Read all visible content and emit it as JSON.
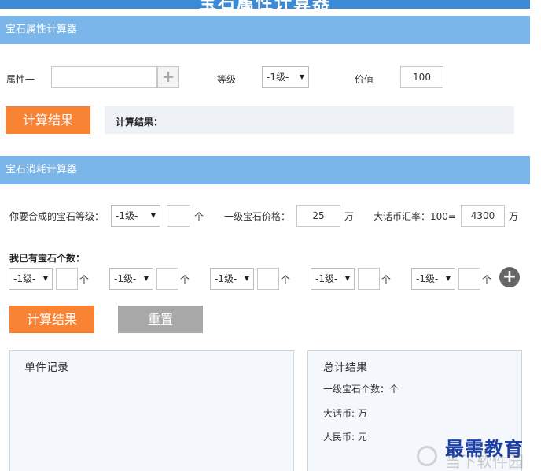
{
  "banner": {
    "title": "宝石属性计算器"
  },
  "attr_calc": {
    "header": "宝石属性计算器",
    "attr_label": "属性一",
    "attr_value": "",
    "level_label": "等级",
    "level_select": "-1级-",
    "value_label": "价值",
    "value_input": "100",
    "calc_button": "计算结果",
    "result_label": "计算结果："
  },
  "consume_calc": {
    "header": "宝石消耗计算器",
    "target_level_label": "你要合成的宝石等级：",
    "target_level_select": "-1级-",
    "target_count": "",
    "unit_ge": "个",
    "price_label": "一级宝石价格：",
    "price_value": "25",
    "unit_wan": "万",
    "rate_label": "大话币汇率：100=",
    "rate_value": "4300",
    "owned_label": "我已有宝石个数：",
    "owned_rows": [
      {
        "level": "-1级-",
        "count": "",
        "unit": "个"
      },
      {
        "level": "-1级-",
        "count": "",
        "unit": "个"
      },
      {
        "level": "-1级-",
        "count": "",
        "unit": "个"
      },
      {
        "level": "-1级-",
        "count": "",
        "unit": "个"
      },
      {
        "level": "-1级-",
        "count": "",
        "unit": "个"
      }
    ],
    "add_icon": "plus-circle-icon",
    "calc_button": "计算结果",
    "reset_button": "重置"
  },
  "records": {
    "title": "单件记录"
  },
  "totals": {
    "title": "总计结果",
    "gem_count": "一级宝石个数：个",
    "dahua_coin": "大话币: 万",
    "rmb": "人民币: 元"
  },
  "watermark": {
    "main": "最需教育",
    "sub": "当下软件园"
  },
  "colors": {
    "header_bg": "#7ab6ea",
    "orange": "#f98335",
    "gray": "#a8a8a8",
    "banner": "#3a8ad6"
  }
}
